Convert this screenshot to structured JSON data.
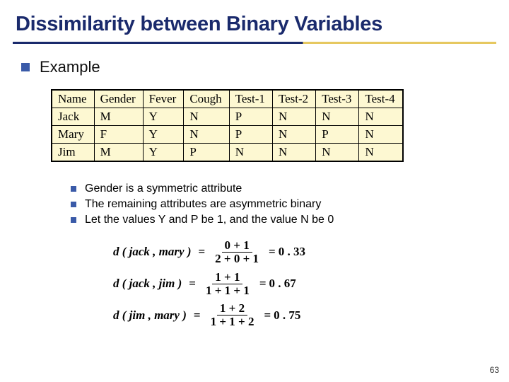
{
  "title": "Dissimilarity between Binary Variables",
  "example_label": "Example",
  "table": {
    "headers": [
      "Name",
      "Gender",
      "Fever",
      "Cough",
      "Test-1",
      "Test-2",
      "Test-3",
      "Test-4"
    ],
    "rows": [
      [
        "Jack",
        "M",
        "Y",
        "N",
        "P",
        "N",
        "N",
        "N"
      ],
      [
        "Mary",
        "F",
        "Y",
        "N",
        "P",
        "N",
        "P",
        "N"
      ],
      [
        "Jim",
        "M",
        "Y",
        "P",
        "N",
        "N",
        "N",
        "N"
      ]
    ]
  },
  "sub_bullets": [
    "Gender is a symmetric attribute",
    "The remaining attributes are asymmetric binary",
    "Let the values Y and P be 1, and the value N be 0"
  ],
  "equations": [
    {
      "lhs": "d ( jack , mary )",
      "num": "0 + 1",
      "den": "2 + 0 + 1",
      "result": "0 . 33"
    },
    {
      "lhs": "d ( jack , jim )",
      "num": "1 + 1",
      "den": "1 + 1 + 1",
      "result": "0 . 67"
    },
    {
      "lhs": "d ( jim , mary )",
      "num": "1 + 2",
      "den": "1 + 1 + 2",
      "result": "0 . 75"
    }
  ],
  "page_number": "63"
}
